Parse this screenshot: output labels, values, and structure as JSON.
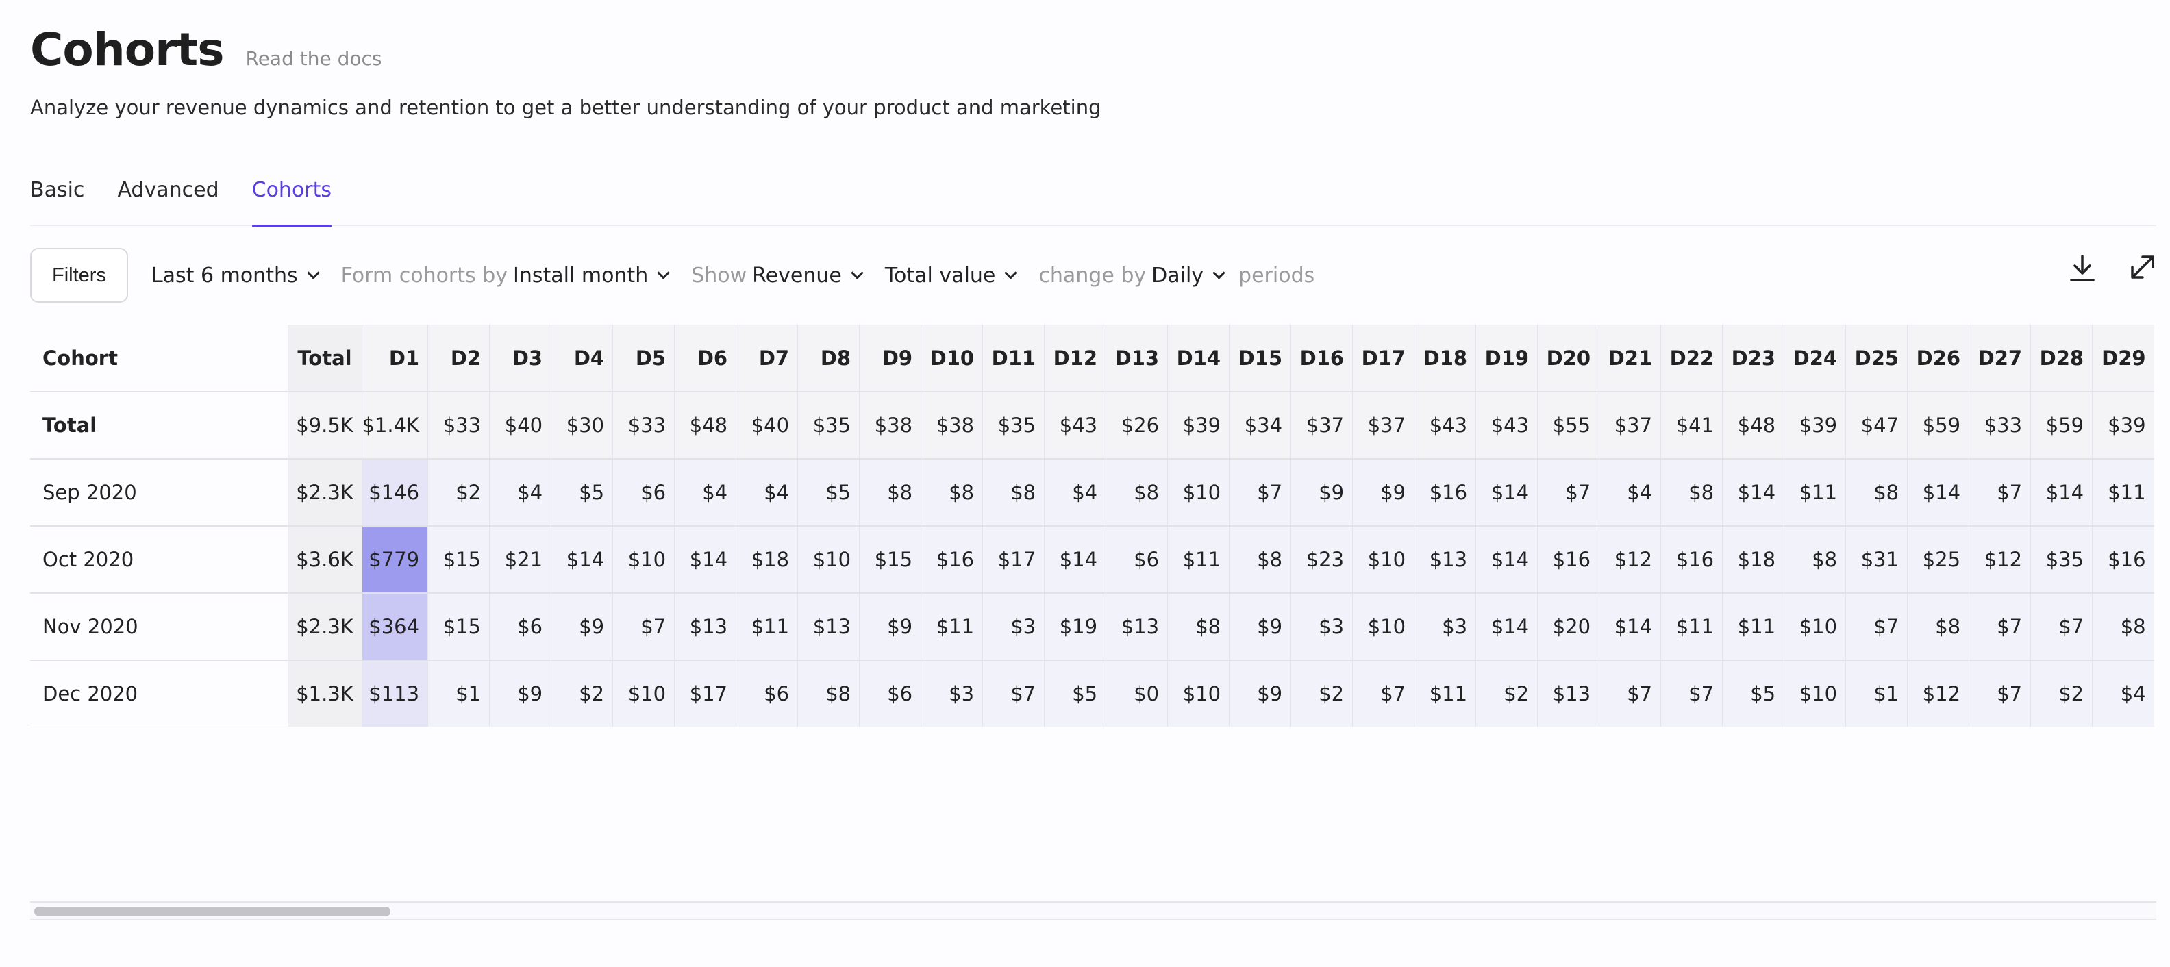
{
  "header": {
    "title": "Cohorts",
    "docs_link": "Read the docs",
    "subtitle": "Analyze your revenue dynamics and retention to get a better understanding of your product and marketing"
  },
  "tabs": [
    {
      "label": "Basic",
      "active": false
    },
    {
      "label": "Advanced",
      "active": false
    },
    {
      "label": "Cohorts",
      "active": true
    }
  ],
  "toolbar": {
    "filters_label": "Filters",
    "period": "Last 6 months",
    "form_cohorts_prefix": "Form cohorts by",
    "form_cohorts_value": "Install month",
    "show_prefix": "Show",
    "show_value": "Revenue",
    "value_type": "Total value",
    "change_by_prefix": "change by",
    "change_by_value": "Daily",
    "periods_suffix": "periods",
    "icons": [
      "download-icon",
      "expand-icon"
    ]
  },
  "colors": {
    "accent": "#5a3fe0",
    "heat_high": "#9c9bee",
    "heat_mid": "#c9c8f5",
    "heat_low": "#e6e5f8",
    "cell_bg": "#f2f2fb"
  },
  "table": {
    "cohort_header": "Cohort",
    "total_header": "Total",
    "day_headers": [
      "D1",
      "D2",
      "D3",
      "D4",
      "D5",
      "D6",
      "D7",
      "D8",
      "D9",
      "D10",
      "D11",
      "D12",
      "D13",
      "D14",
      "D15",
      "D16",
      "D17",
      "D18",
      "D19",
      "D20",
      "D21",
      "D22",
      "D23",
      "D24",
      "D25",
      "D26",
      "D27",
      "D28",
      "D29"
    ],
    "total_row": {
      "label": "Total",
      "total": "$9.5K",
      "values": [
        "$1.4K",
        "$33",
        "$40",
        "$30",
        "$33",
        "$48",
        "$40",
        "$35",
        "$38",
        "$38",
        "$35",
        "$43",
        "$26",
        "$39",
        "$34",
        "$37",
        "$37",
        "$43",
        "$43",
        "$55",
        "$37",
        "$41",
        "$48",
        "$39",
        "$47",
        "$59",
        "$33",
        "$59",
        "$39"
      ]
    },
    "rows": [
      {
        "label": "Sep 2020",
        "total": "$2.3K",
        "values": [
          "$146",
          "$2",
          "$4",
          "$5",
          "$6",
          "$4",
          "$4",
          "$5",
          "$8",
          "$8",
          "$8",
          "$4",
          "$8",
          "$10",
          "$7",
          "$9",
          "$9",
          "$16",
          "$14",
          "$7",
          "$4",
          "$8",
          "$14",
          "$11",
          "$8",
          "$14",
          "$7",
          "$14",
          "$11"
        ]
      },
      {
        "label": "Oct 2020",
        "total": "$3.6K",
        "values": [
          "$779",
          "$15",
          "$21",
          "$14",
          "$10",
          "$14",
          "$18",
          "$10",
          "$15",
          "$16",
          "$17",
          "$14",
          "$6",
          "$11",
          "$8",
          "$23",
          "$10",
          "$13",
          "$14",
          "$16",
          "$12",
          "$16",
          "$18",
          "$8",
          "$31",
          "$25",
          "$12",
          "$35",
          "$16"
        ]
      },
      {
        "label": "Nov 2020",
        "total": "$2.3K",
        "values": [
          "$364",
          "$15",
          "$6",
          "$9",
          "$7",
          "$13",
          "$11",
          "$13",
          "$9",
          "$11",
          "$3",
          "$19",
          "$13",
          "$8",
          "$9",
          "$3",
          "$10",
          "$3",
          "$14",
          "$20",
          "$14",
          "$11",
          "$11",
          "$10",
          "$7",
          "$8",
          "$7",
          "$7",
          "$8"
        ]
      },
      {
        "label": "Dec 2020",
        "total": "$1.3K",
        "values": [
          "$113",
          "$1",
          "$9",
          "$2",
          "$10",
          "$17",
          "$6",
          "$8",
          "$6",
          "$3",
          "$7",
          "$5",
          "$0",
          "$10",
          "$9",
          "$2",
          "$7",
          "$11",
          "$2",
          "$13",
          "$7",
          "$7",
          "$5",
          "$10",
          "$1",
          "$12",
          "$7",
          "$2",
          "$4"
        ]
      }
    ]
  }
}
